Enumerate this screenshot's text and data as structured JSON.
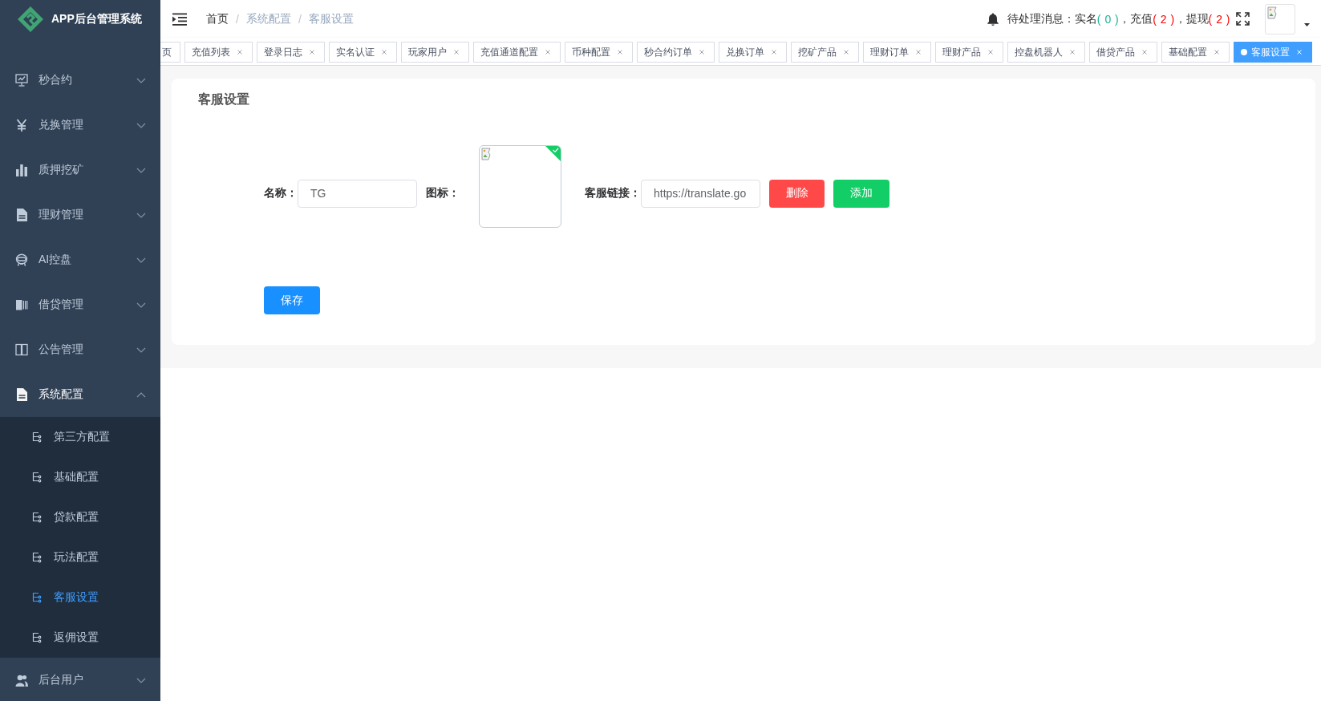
{
  "sidebar": {
    "title": "APP后台管理系统",
    "menu": [
      {
        "label": "秒合约",
        "expanded": false
      },
      {
        "label": "兑换管理",
        "expanded": false
      },
      {
        "label": "质押挖矿",
        "expanded": false
      },
      {
        "label": "理财管理",
        "expanded": false
      },
      {
        "label": "AI控盘",
        "expanded": false
      },
      {
        "label": "借贷管理",
        "expanded": false
      },
      {
        "label": "公告管理",
        "expanded": false
      },
      {
        "label": "系统配置",
        "expanded": true,
        "children": [
          {
            "label": "第三方配置",
            "selected": false
          },
          {
            "label": "基础配置",
            "selected": false
          },
          {
            "label": "贷款配置",
            "selected": false
          },
          {
            "label": "玩法配置",
            "selected": false
          },
          {
            "label": "客服设置",
            "selected": true
          },
          {
            "label": "返佣设置",
            "selected": false
          }
        ]
      },
      {
        "label": "后台用户",
        "expanded": false
      }
    ]
  },
  "header": {
    "breadcrumb": [
      {
        "label": "首页",
        "kind": "link"
      },
      {
        "separator": "/",
        "label": "系统配置",
        "kind": "text"
      },
      {
        "separator": "/",
        "label": "客服设置",
        "kind": "text"
      }
    ],
    "notice": {
      "label": "待处理消息：",
      "items": [
        {
          "name": "实名",
          "count": "( 0 )",
          "color": "#1ab394",
          "separator": "，"
        },
        {
          "name": "充值",
          "count": "( 2 )",
          "color": "#ff0000",
          "separator": "，"
        },
        {
          "name": "提现",
          "count": "( 2 )",
          "color": "#ff0000"
        }
      ]
    }
  },
  "tabs": [
    {
      "label": "页",
      "selected": false,
      "closable": false
    },
    {
      "label": "充值列表",
      "selected": false,
      "closable": true
    },
    {
      "label": "登录日志",
      "selected": false,
      "closable": true
    },
    {
      "label": "实名认证",
      "selected": false,
      "closable": true
    },
    {
      "label": "玩家用户",
      "selected": false,
      "closable": true
    },
    {
      "label": "充值通道配置",
      "selected": false,
      "closable": true
    },
    {
      "label": "币种配置",
      "selected": false,
      "closable": true
    },
    {
      "label": "秒合约订单",
      "selected": false,
      "closable": true
    },
    {
      "label": "兑换订单",
      "selected": false,
      "closable": true
    },
    {
      "label": "挖矿产品",
      "selected": false,
      "closable": true
    },
    {
      "label": "理财订单",
      "selected": false,
      "closable": true
    },
    {
      "label": "理财产品",
      "selected": false,
      "closable": true
    },
    {
      "label": "控盘机器人",
      "selected": false,
      "closable": true
    },
    {
      "label": "借贷产品",
      "selected": false,
      "closable": true
    },
    {
      "label": "基础配置",
      "selected": false,
      "closable": true
    },
    {
      "label": "客服设置",
      "selected": true,
      "closable": true
    }
  ],
  "page": {
    "title": "客服设置",
    "entries": [
      {
        "name_label": "名称：",
        "name_value": "TG",
        "icon_label": "图标：",
        "icon_uploaded": true,
        "link_label": "客服链接：",
        "link_value": "https://translate.go",
        "delete_button": "删除",
        "add_button": "添加"
      }
    ],
    "save_button": "保存"
  }
}
